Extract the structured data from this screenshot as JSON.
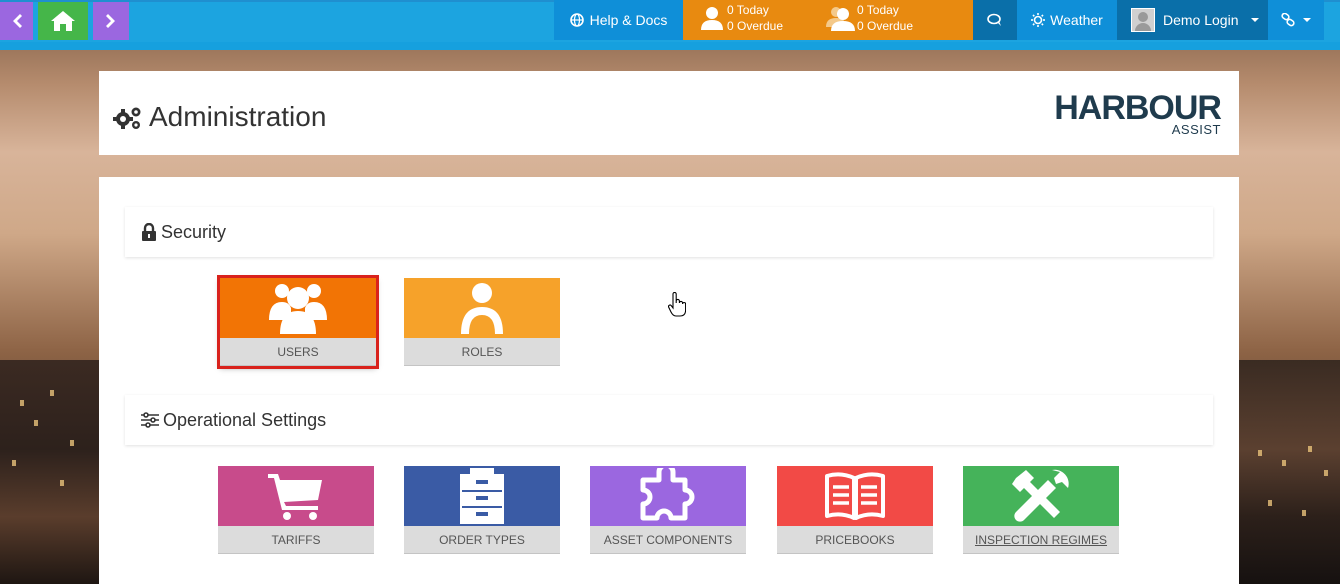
{
  "nav": {
    "back_icon": "chevron-left-icon",
    "home_icon": "home-icon",
    "forward_icon": "chevron-right-icon"
  },
  "topbar": {
    "help_label": "Help & Docs",
    "task_mine": {
      "today": "0 Today",
      "overdue": "0 Overdue"
    },
    "task_team": {
      "today": "0 Today",
      "overdue": "0 Overdue"
    },
    "weather_label": "Weather",
    "user_label": "Demo Login",
    "colors": {
      "bar": "#1ca4e0",
      "tasks": "#e88a10",
      "dark": "#0a6fa9",
      "home": "#45b649",
      "arrows": "#9b67e0"
    }
  },
  "header": {
    "title": "Administration",
    "logo_main": "HARBOUR",
    "logo_sub": "ASSIST"
  },
  "sections": {
    "security": {
      "title": "Security",
      "tiles": [
        {
          "label": "USERS",
          "color": "#f27405",
          "icon": "users-icon"
        },
        {
          "label": "ROLES",
          "color": "#f6a22a",
          "icon": "user-icon"
        }
      ]
    },
    "operational": {
      "title": "Operational Settings",
      "tiles": [
        {
          "label": "TARIFFS",
          "color": "#c84b8b",
          "icon": "shopping-cart-icon"
        },
        {
          "label": "ORDER TYPES",
          "color": "#3a5ba5",
          "icon": "filing-cabinet-icon"
        },
        {
          "label": "ASSET COMPONENTS",
          "color": "#9b67e0",
          "icon": "puzzle-icon"
        },
        {
          "label": "PRICEBOOKS",
          "color": "#f24a46",
          "icon": "open-book-icon"
        },
        {
          "label": "INSPECTION REGIMES",
          "color": "#45b35a",
          "icon": "tools-icon"
        }
      ]
    }
  }
}
